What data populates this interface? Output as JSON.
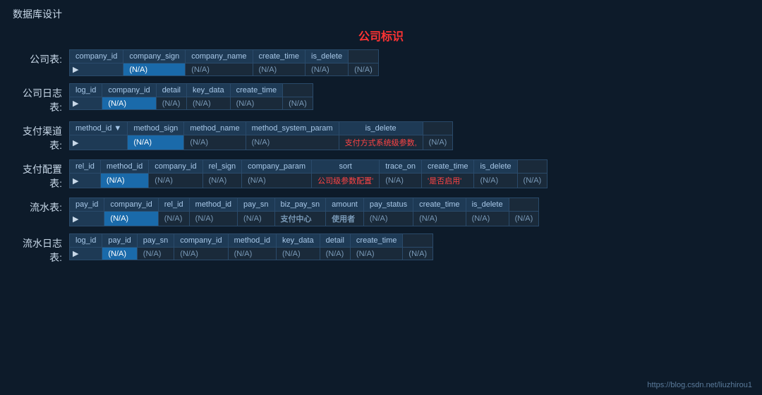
{
  "page": {
    "title": "数据库设计",
    "section_label": "公司标识",
    "footer_url": "https://blog.csdn.net/liuzhirou1"
  },
  "tables": [
    {
      "id": "company",
      "label": "公司表:",
      "columns": [
        "company_id",
        "company_sign",
        "company_name",
        "create_time",
        "is_delete"
      ],
      "row": [
        "(N/A)",
        "(N/A)",
        "(N/A)",
        "(N/A)",
        "(N/A)"
      ],
      "selected_col": 0,
      "hint": null
    },
    {
      "id": "company_log",
      "label": "公司日志表:",
      "columns": [
        "log_id",
        "company_id",
        "detail",
        "key_data",
        "create_time"
      ],
      "row": [
        "(N/A)",
        "(N/A)",
        "(N/A)",
        "(N/A)",
        "(N/A)"
      ],
      "selected_col": 0,
      "hint": null
    },
    {
      "id": "pay_method",
      "label": "支付渠道表:",
      "columns": [
        "method_id ▼",
        "method_sign",
        "method_name",
        "method_system_param",
        "is_delete"
      ],
      "row": [
        "(N/A)",
        "(N/A)",
        "(N/A)",
        "支付方式系统级参数,",
        "(N/A)"
      ],
      "selected_col": 0,
      "hint_col": 3,
      "hint": "支付方式系统级参数,"
    },
    {
      "id": "pay_config",
      "label": "支付配置表:",
      "columns": [
        "rel_id",
        "method_id",
        "company_id",
        "rel_sign",
        "company_param",
        "sort",
        "trace_on",
        "create_time",
        "is_delete"
      ],
      "row": [
        "(N/A)",
        "(N/A)",
        "(N/A)",
        "(N/A)",
        "公司级参数配置'",
        "(N/A)",
        "'是否启用'",
        "(N/A)",
        "(N/A)"
      ],
      "selected_col": 0,
      "hint": null
    },
    {
      "id": "flow",
      "label": "流水表:",
      "columns": [
        "pay_id",
        "company_id",
        "rel_id",
        "method_id",
        "pay_sn",
        "biz_pay_sn",
        "amount",
        "pay_status",
        "create_time",
        "is_delete"
      ],
      "row": [
        "(N/A)",
        "(N/A)",
        "(N/A)",
        "(N/A)",
        "支付中心",
        "使用者",
        "(N/A)",
        "(N/A)",
        "(N/A)",
        "(N/A)"
      ],
      "selected_col": 0,
      "hint_col": 4,
      "hint2_col": 5
    },
    {
      "id": "flow_log",
      "label": "流水日志表:",
      "columns": [
        "log_id",
        "pay_id",
        "pay_sn",
        "company_id",
        "method_id",
        "key_data",
        "detail",
        "create_time"
      ],
      "row": [
        "(N/A)",
        "(N/A)",
        "(N/A)",
        "(N/A)",
        "(N/A)",
        "(N/A)",
        "(N/A)",
        "(N/A)"
      ],
      "selected_col": 0,
      "hint": null
    }
  ]
}
